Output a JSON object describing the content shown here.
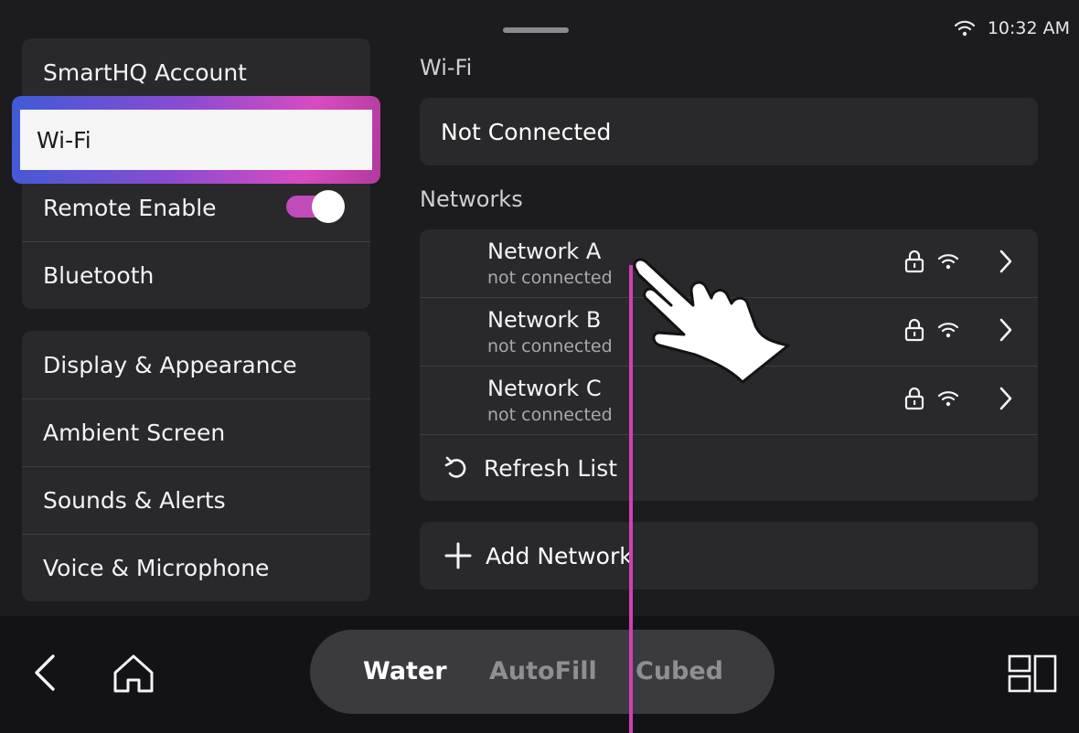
{
  "status": {
    "time": "10:32 AM",
    "wifi_icon": "wifi-icon"
  },
  "sidebar": {
    "group1": [
      {
        "label": "SmartHQ Account"
      },
      {
        "label": "Wi-Fi",
        "selected": true
      },
      {
        "label": "Remote Enable",
        "toggle": true
      },
      {
        "label": "Bluetooth"
      }
    ],
    "group2": [
      {
        "label": "Display & Appearance"
      },
      {
        "label": "Ambient Screen"
      },
      {
        "label": "Sounds & Alerts"
      },
      {
        "label": "Voice & Microphone"
      }
    ]
  },
  "main": {
    "wifi_heading": "Wi-Fi",
    "status_text": "Not Connected",
    "networks_heading": "Networks",
    "networks": [
      {
        "name": "Network A",
        "status": "not connected"
      },
      {
        "name": "Network B",
        "status": "not connected"
      },
      {
        "name": "Network C",
        "status": "not connected"
      }
    ],
    "refresh_label": "Refresh List",
    "add_label": "Add Network"
  },
  "bottom": {
    "tabs": [
      "Water",
      "AutoFill",
      "Cubed"
    ],
    "active_tab": "Water"
  },
  "colors": {
    "accent": "#c04bb9",
    "background": "#1c1c1e",
    "panel": "#29292c"
  }
}
